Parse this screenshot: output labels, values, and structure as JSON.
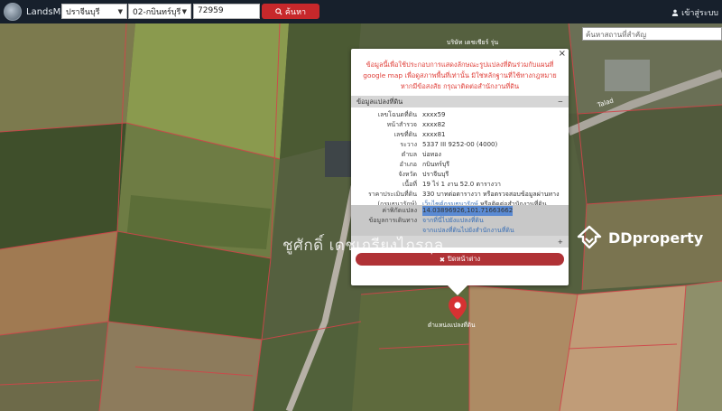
{
  "header": {
    "brand": "LandsMaps",
    "province": "ปราจีนบุรี",
    "district": "02-กบินทร์บุรี",
    "parcel_number": "72959",
    "search_label": "ค้นหา",
    "login_label": "เข้าสู่ระบบ"
  },
  "map": {
    "place_search_placeholder": "ค้นหาสถานที่สำคัญ",
    "label_top": "บริษัท เดชเชียร์ รุ่น",
    "label_road": "Talad",
    "pin_label": "ตำแหน่งแปลงที่ดิน"
  },
  "popup": {
    "notice": "ข้อมูลนี้เพื่อใช้ประกอบการแสดงลักษณะรูปแปลงที่ดินร่วมกับแผนที่ google map เพื่อดูสภาพพื้นที่เท่านั้น มิใช่หลักฐานที่ใช้ทางกฎหมาย หากมีข้อสงสัย กรุณาติดต่อสำนักงานที่ดิน",
    "section_title": "ข้อมูลแปลงที่ดิน",
    "section_toggle": "−",
    "rows": [
      {
        "k": "เลขโฉนดที่ดิน",
        "v": "xxxx59"
      },
      {
        "k": "หน้าสำรวจ",
        "v": "xxxx82"
      },
      {
        "k": "เลขที่ดิน",
        "v": "xxxx81"
      },
      {
        "k": "ระวาง",
        "v": "5337 III 9252-00 (4000)"
      },
      {
        "k": "ตำบล",
        "v": "บ่อทอง"
      },
      {
        "k": "อำเภอ",
        "v": "กบินทร์บุรี"
      },
      {
        "k": "จังหวัด",
        "v": "ปราจีนบุรี"
      },
      {
        "k": "เนื้อที่",
        "v": "19 ไร่ 1 งาน 52.0 ตารางวา"
      },
      {
        "k": "ราคาประเมินที่ดิน",
        "v": "330 บาทต่อตารางวา หรือตรวจสอบข้อมูลผ่านทาง"
      },
      {
        "k": "(กรมธนารักษ์)",
        "v_link": "เว็บไซต์กรมธนารักษ์",
        "v_rest": " หรือติดต่อสำนักงานที่ดิน"
      }
    ],
    "coord_label": "ค่าพิกัดแปลง",
    "coord_value": "14.03896926,101.71663662",
    "route_label": "ข้อมูลการเดินทาง",
    "route_link1": "จากที่นี่ไปยังแปลงที่ดิน",
    "route_link2": "จากแปลงที่ดินไปยังสำนักงานที่ดิน",
    "section2_toggle": "+",
    "close_label": "ปิดหน้าต่าง"
  },
  "watermark": {
    "agent": "ชูศักดิ์ เดชเกรียงไกรกุล",
    "brand": "DDproperty"
  }
}
